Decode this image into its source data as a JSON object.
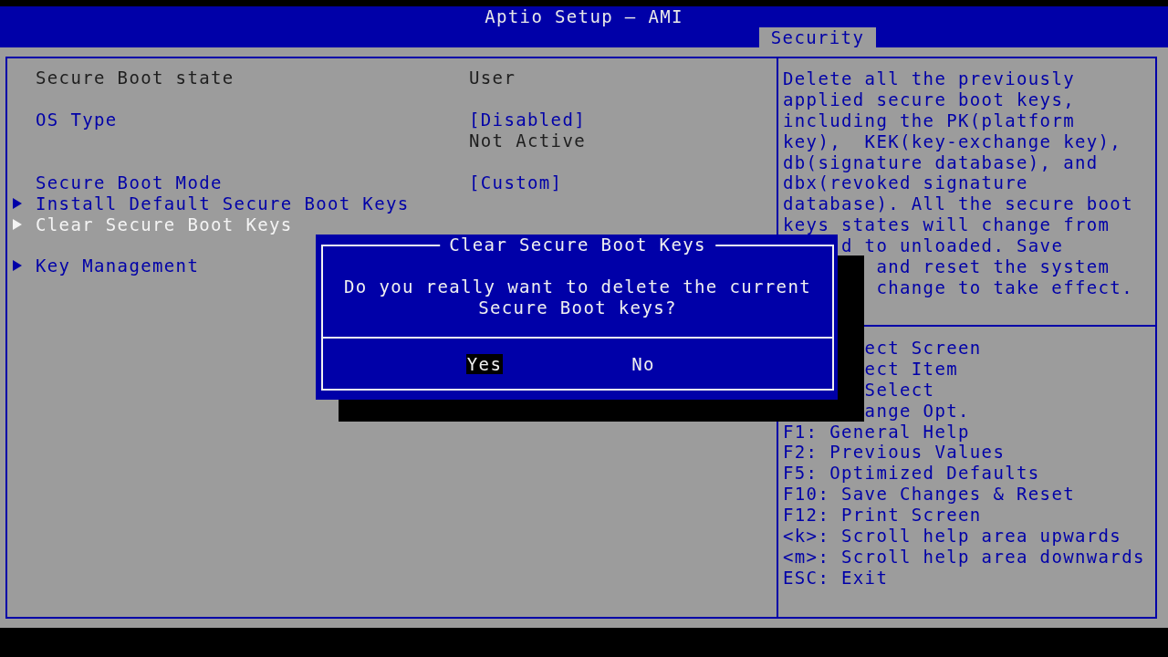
{
  "window": {
    "title": "Aptio Setup – AMI"
  },
  "tabs": [
    {
      "label": "Security",
      "selected": true
    }
  ],
  "settings": {
    "sections": [
      [
        {
          "kind": "info",
          "label": "Secure Boot state",
          "value": "User",
          "selected": false
        }
      ],
      [
        {
          "kind": "option",
          "label": "OS Type",
          "value": "[Disabled]",
          "selected": false
        },
        {
          "kind": "status",
          "value": "Not Active",
          "selected": false
        }
      ],
      [
        {
          "kind": "option",
          "label": "Secure Boot Mode",
          "value": "[Custom]",
          "selected": false
        },
        {
          "kind": "submenu",
          "label": "Install Default Secure Boot Keys",
          "selected": false
        },
        {
          "kind": "submenu",
          "label": "Clear Secure Boot Keys",
          "selected": true
        }
      ],
      [
        {
          "kind": "submenu",
          "label": "Key Management",
          "selected": false
        }
      ]
    ]
  },
  "help_text": [
    "Delete all the previously",
    "applied secure boot keys,",
    "including the PK(platform",
    "key),  KEK(key-exchange key),",
    "db(signature database), and",
    "dbx(revoked signature",
    "database). All the secure boot",
    "keys states will change from",
    "d to unloaded. Save",
    "and reset the system",
    "change to take effect."
  ],
  "key_help": [
    "ect Screen",
    "ect Item",
    "Select",
    "ange Opt.",
    "F1: General Help",
    "F2: Previous Values",
    "F5: Optimized Defaults",
    "F10: Save Changes & Reset",
    "F12: Print Screen",
    "<k>: Scroll help area upwards",
    "<m>: Scroll help area downwards",
    "ESC: Exit"
  ],
  "dialog": {
    "title": "Clear Secure Boot Keys",
    "message": "Do you really want to delete the current Secure Boot keys?",
    "buttons": [
      {
        "label": "Yes",
        "selected": true
      },
      {
        "label": "No",
        "selected": false
      }
    ]
  }
}
